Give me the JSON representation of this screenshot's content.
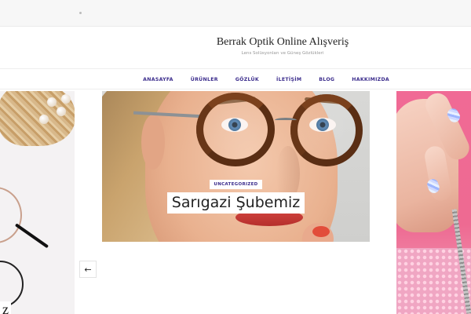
{
  "site": {
    "title": "Berrak Optik Online Alışveriş",
    "tagline": "Lens Solüsyonları ve Güneş Gözlükleri"
  },
  "nav": {
    "items": [
      "ANASAYFA",
      "ÜRÜNLER",
      "GÖZLÜK",
      "İLETİŞİM",
      "BLOG",
      "HAKKIMIZDA"
    ]
  },
  "slider": {
    "active": {
      "category": "UNCATEGORIZED",
      "title": "Sarıgazi Şubemiz"
    },
    "left_cut_text": "z",
    "prev_icon": "arrow-left-icon",
    "prev_label": "←"
  },
  "colors": {
    "accent": "#3b2c8c",
    "topbar": "#f7f7f7",
    "right_slide_pink": "#f06a95"
  }
}
